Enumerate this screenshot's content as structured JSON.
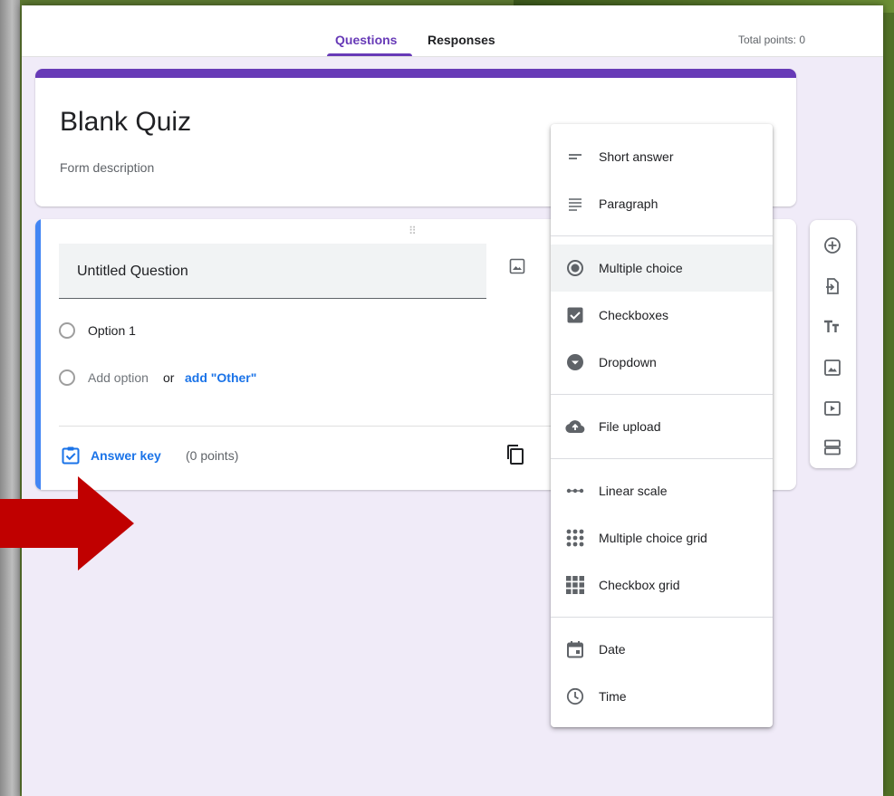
{
  "tabs": {
    "questions": "Questions",
    "responses": "Responses"
  },
  "total_points": "Total points: 0",
  "form": {
    "title": "Blank Quiz",
    "description": "Form description"
  },
  "question": {
    "title": "Untitled Question",
    "option1": "Option 1",
    "add_option": "Add option",
    "or": "or",
    "add_other": "add \"Other\"",
    "answer_key": "Answer key",
    "points": "(0 points)"
  },
  "menu": {
    "items": [
      {
        "label": "Short answer",
        "icon": "short-answer-icon"
      },
      {
        "label": "Paragraph",
        "icon": "paragraph-icon"
      },
      {
        "label": "Multiple choice",
        "icon": "radio-checked-icon",
        "selected": true
      },
      {
        "label": "Checkboxes",
        "icon": "checkbox-icon"
      },
      {
        "label": "Dropdown",
        "icon": "dropdown-icon"
      },
      {
        "label": "File upload",
        "icon": "cloud-upload-icon"
      },
      {
        "label": "Linear scale",
        "icon": "linear-scale-icon"
      },
      {
        "label": "Multiple choice grid",
        "icon": "grid-dots-icon"
      },
      {
        "label": "Checkbox grid",
        "icon": "grid-squares-icon"
      },
      {
        "label": "Date",
        "icon": "calendar-icon"
      },
      {
        "label": "Time",
        "icon": "clock-icon"
      }
    ]
  },
  "side_toolbar": [
    "add-question-icon",
    "import-questions-icon",
    "add-title-icon",
    "add-image-icon",
    "add-video-icon",
    "add-section-icon"
  ],
  "colors": {
    "accent": "#673ab7",
    "question_bar": "#4285f4",
    "link": "#1a73e8",
    "background": "#f0ebf8",
    "arrow": "#c00000"
  }
}
